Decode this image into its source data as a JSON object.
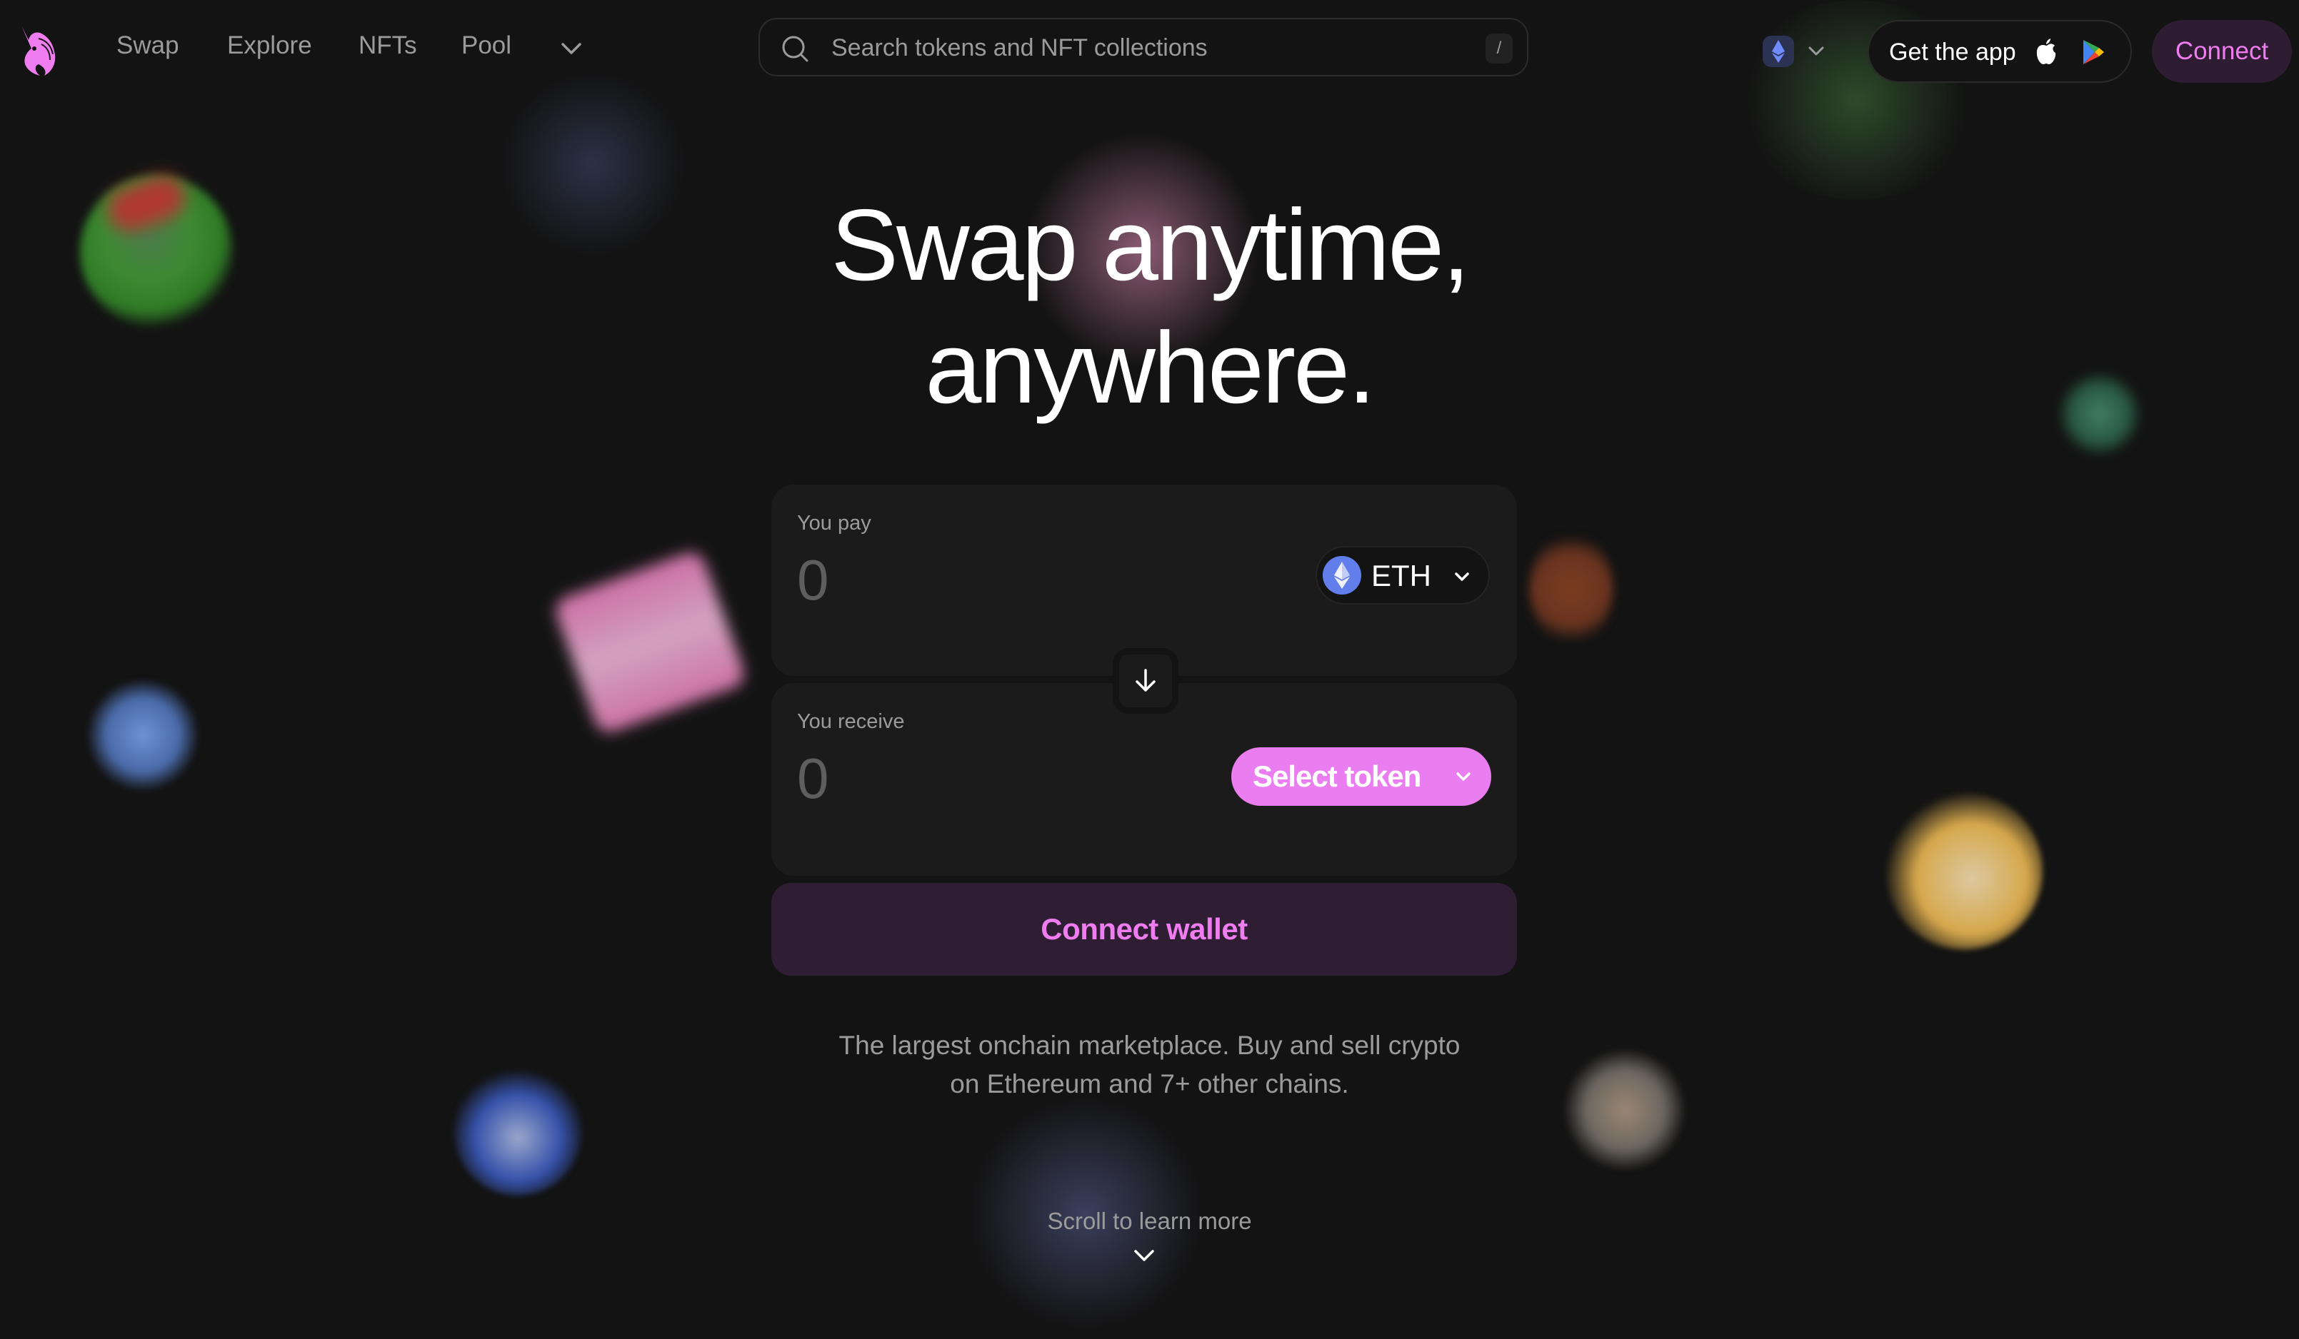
{
  "nav": {
    "links": [
      "Swap",
      "Explore",
      "NFTs",
      "Pool"
    ],
    "more_icon": "chevron-down-icon",
    "search_placeholder": "Search tokens and NFT collections",
    "search_shortcut": "/",
    "chain_icon": "ethereum-icon",
    "get_app_label": "Get the app",
    "connect_label": "Connect"
  },
  "hero": {
    "line1": "Swap anytime,",
    "line2": "anywhere."
  },
  "swap": {
    "pay_label": "You pay",
    "pay_amount": "0",
    "pay_token": "ETH",
    "receive_label": "You receive",
    "receive_amount": "0",
    "select_token_label": "Select token",
    "connect_wallet_label": "Connect wallet"
  },
  "tagline": {
    "line1": "The largest onchain marketplace. Buy and sell crypto",
    "line2": "on Ethereum and 7+ other chains."
  },
  "scroll_label": "Scroll to learn more",
  "colors": {
    "background": "#131313",
    "accent": "#ea7def",
    "accent_text": "#f07df0",
    "accent_bg": "#2e1d33",
    "surface": "#1b1b1b",
    "muted_text": "#9b9b9b",
    "eth_blue": "#627eea"
  }
}
